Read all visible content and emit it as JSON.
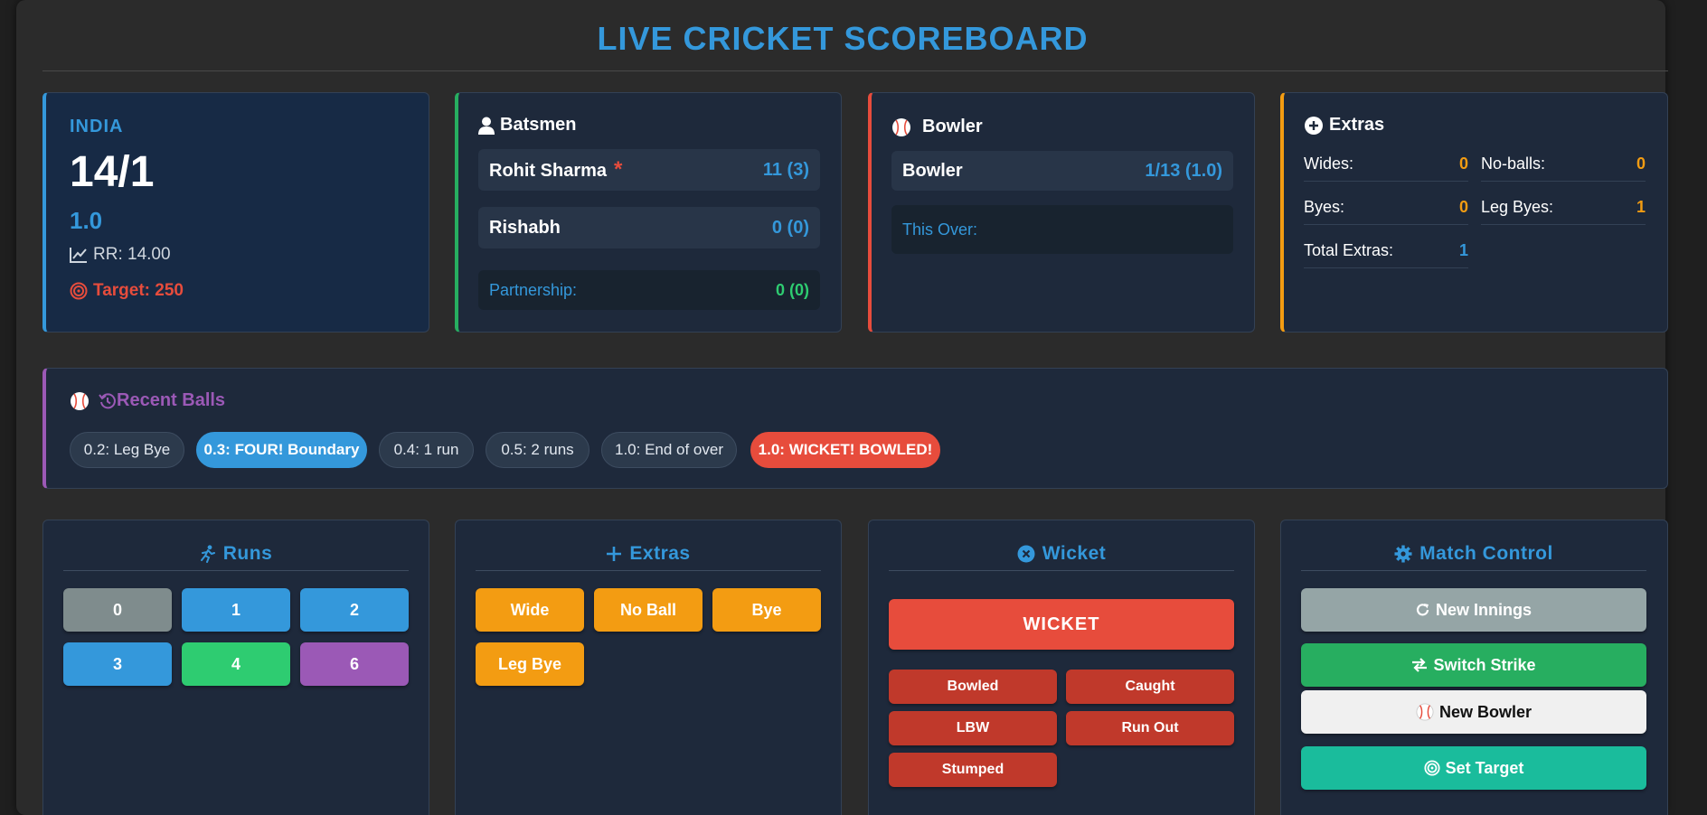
{
  "title": "LIVE CRICKET SCOREBOARD",
  "score_card": {
    "team": "INDIA",
    "score": "14/1",
    "overs": "1.0",
    "run_rate": "RR: 14.00",
    "target": "Target: 250"
  },
  "batsmen": {
    "heading": "Batsmen",
    "rows": [
      {
        "name": "Rohit Sharma",
        "on_strike_marker": "*",
        "score": "11 (3)"
      },
      {
        "name": "Rishabh",
        "score": "0 (0)"
      }
    ],
    "partnership_label": "Partnership:",
    "partnership_value": "0 (0)"
  },
  "bowler": {
    "heading": "Bowler",
    "name": "Bowler",
    "figures": "1/13 (1.0)",
    "this_over_label": "This Over:"
  },
  "extras": {
    "heading": "Extras",
    "wides_label": "Wides:",
    "wides": "0",
    "noballs_label": "No-balls:",
    "noballs": "0",
    "byes_label": "Byes:",
    "byes": "0",
    "legbyes_label": "Leg Byes:",
    "legbyes": "1",
    "total_label": "Total Extras:",
    "total": "1"
  },
  "recent": {
    "heading": "Recent Balls",
    "balls": [
      "0.2: Leg Bye",
      "0.3: FOUR! Boundary",
      "0.4: 1 run",
      "0.5: 2 runs",
      "1.0: End of over",
      "1.0: WICKET! BOWLED!"
    ]
  },
  "runs_panel": {
    "heading": "Runs",
    "buttons": [
      "0",
      "1",
      "2",
      "3",
      "4",
      "6"
    ]
  },
  "extras_panel": {
    "heading": "Extras",
    "buttons": [
      "Wide",
      "No Ball",
      "Bye",
      "Leg Bye"
    ]
  },
  "wicket_panel": {
    "heading": "Wicket",
    "main_button": "WICKET",
    "types": [
      "Bowled",
      "Caught",
      "LBW",
      "Run Out",
      "Stumped"
    ]
  },
  "control_panel": {
    "heading": "Match Control",
    "new_innings": "New Innings",
    "switch_strike": "Switch Strike",
    "new_bowler": "New Bowler",
    "set_target": "Set Target"
  }
}
